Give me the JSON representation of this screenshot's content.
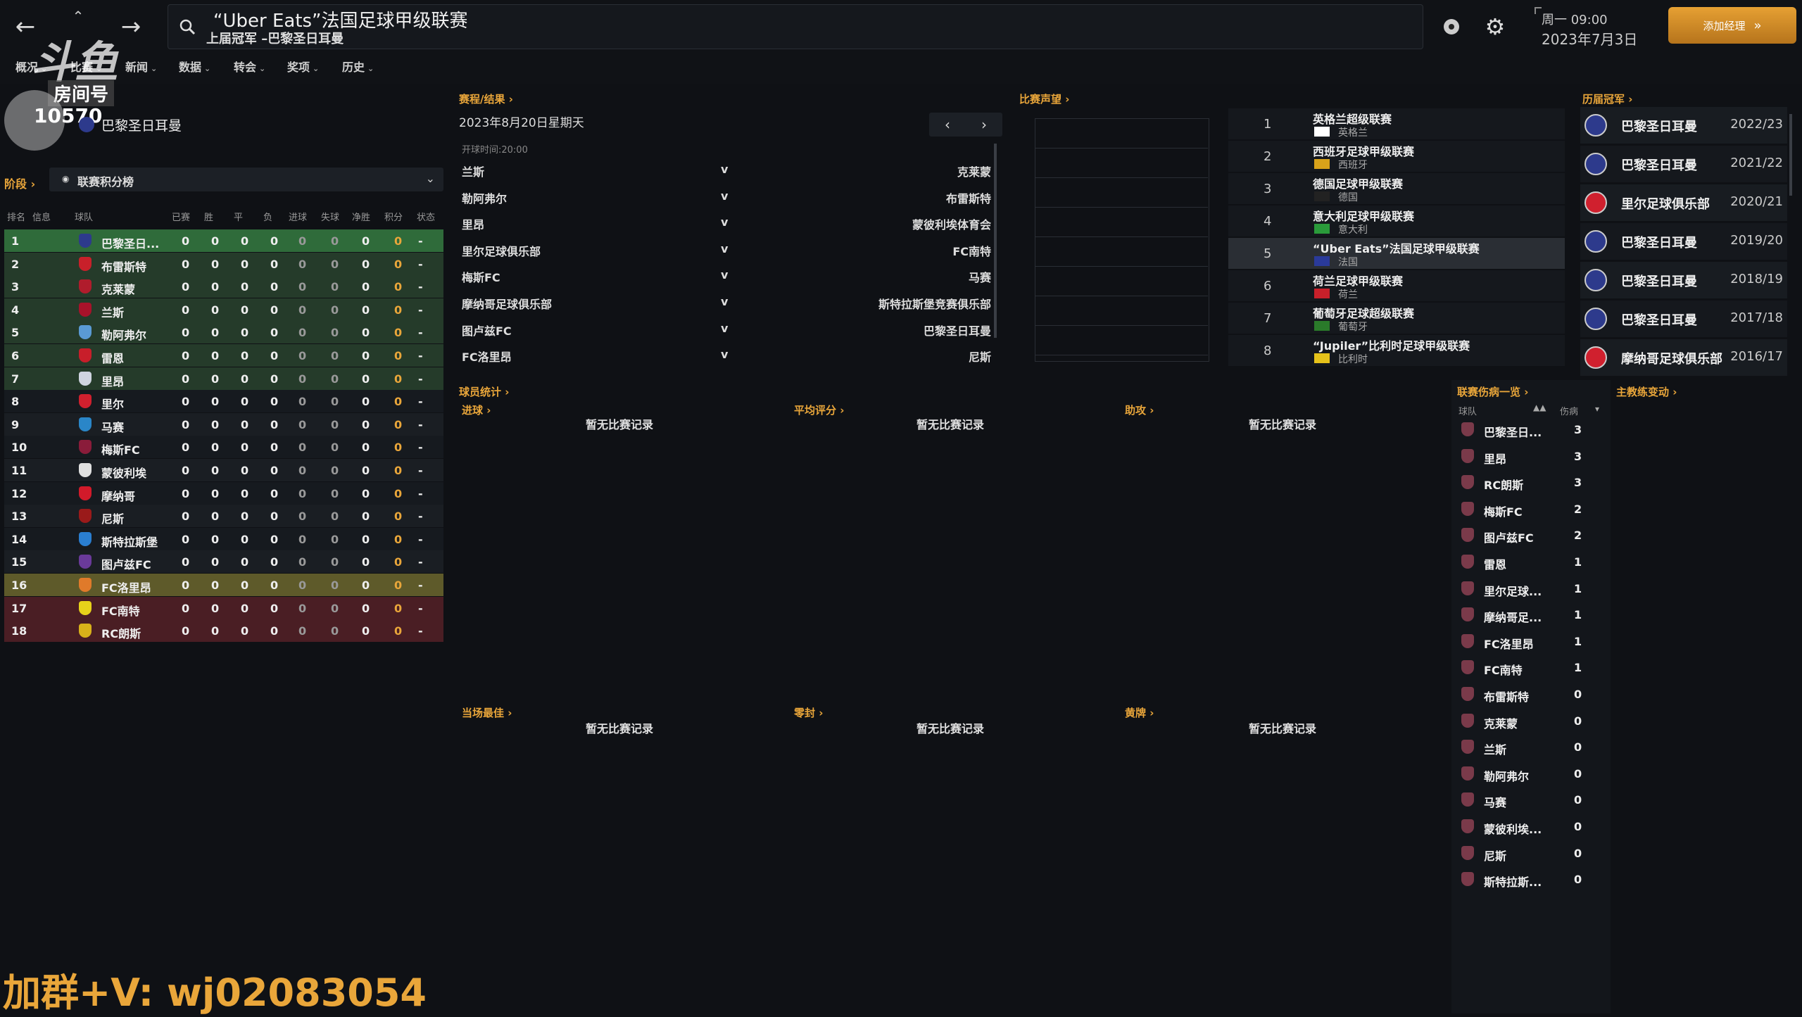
{
  "header": {
    "league_title": "“Uber Eats”法国足球甲级联赛",
    "last_champion": "上届冠军 –巴黎圣日耳曼",
    "weekday_time": "周一 09:00",
    "date": "2023年7月3日",
    "add_manager_label": "添加经理",
    "watermark_logo": "斗鱼",
    "room_label": "房间号",
    "room_number": "10570"
  },
  "menu": [
    {
      "label": "概况"
    },
    {
      "label": "比赛"
    },
    {
      "label": "新闻"
    },
    {
      "label": "数据"
    },
    {
      "label": "转会"
    },
    {
      "label": "奖项"
    },
    {
      "label": "历史"
    }
  ],
  "club_header": {
    "name": "巴黎圣日耳曼"
  },
  "stage": {
    "label": "阶段",
    "selector_label": "联赛积分榜"
  },
  "standings": {
    "columns": [
      "排名",
      "信息",
      "球队",
      "已赛",
      "胜",
      "平",
      "负",
      "进球",
      "失球",
      "净胜",
      "积分",
      "状态"
    ],
    "rows": [
      {
        "pos": "1",
        "team": "巴黎圣日...",
        "p": "0",
        "w": "0",
        "d": "0",
        "l": "0",
        "gf": "0",
        "ga": "0",
        "gd": "0",
        "pts": "0",
        "form": "-",
        "crest": "#2d3a8c"
      },
      {
        "pos": "2",
        "team": "布雷斯特",
        "p": "0",
        "w": "0",
        "d": "0",
        "l": "0",
        "gf": "0",
        "ga": "0",
        "gd": "0",
        "pts": "0",
        "form": "-",
        "crest": "#c8202a"
      },
      {
        "pos": "3",
        "team": "克莱蒙",
        "p": "0",
        "w": "0",
        "d": "0",
        "l": "0",
        "gf": "0",
        "ga": "0",
        "gd": "0",
        "pts": "0",
        "form": "-",
        "crest": "#b01c2c"
      },
      {
        "pos": "4",
        "team": "兰斯",
        "p": "0",
        "w": "0",
        "d": "0",
        "l": "0",
        "gf": "0",
        "ga": "0",
        "gd": "0",
        "pts": "0",
        "form": "-",
        "crest": "#a8122a"
      },
      {
        "pos": "5",
        "team": "勒阿弗尔",
        "p": "0",
        "w": "0",
        "d": "0",
        "l": "0",
        "gf": "0",
        "ga": "0",
        "gd": "0",
        "pts": "0",
        "form": "-",
        "crest": "#5a9ad4"
      },
      {
        "pos": "6",
        "team": "雷恩",
        "p": "0",
        "w": "0",
        "d": "0",
        "l": "0",
        "gf": "0",
        "ga": "0",
        "gd": "0",
        "pts": "0",
        "form": "-",
        "crest": "#c81e2a"
      },
      {
        "pos": "7",
        "team": "里昂",
        "p": "0",
        "w": "0",
        "d": "0",
        "l": "0",
        "gf": "0",
        "ga": "0",
        "gd": "0",
        "pts": "0",
        "form": "-",
        "crest": "#cfd4e0"
      },
      {
        "pos": "8",
        "team": "里尔",
        "p": "0",
        "w": "0",
        "d": "0",
        "l": "0",
        "gf": "0",
        "ga": "0",
        "gd": "0",
        "pts": "0",
        "form": "-",
        "crest": "#d0202e"
      },
      {
        "pos": "9",
        "team": "马赛",
        "p": "0",
        "w": "0",
        "d": "0",
        "l": "0",
        "gf": "0",
        "ga": "0",
        "gd": "0",
        "pts": "0",
        "form": "-",
        "crest": "#2a86c8"
      },
      {
        "pos": "10",
        "team": "梅斯FC",
        "p": "0",
        "w": "0",
        "d": "0",
        "l": "0",
        "gf": "0",
        "ga": "0",
        "gd": "0",
        "pts": "0",
        "form": "-",
        "crest": "#8a1c3a"
      },
      {
        "pos": "11",
        "team": "蒙彼利埃",
        "p": "0",
        "w": "0",
        "d": "0",
        "l": "0",
        "gf": "0",
        "ga": "0",
        "gd": "0",
        "pts": "0",
        "form": "-",
        "crest": "#e0e0e0"
      },
      {
        "pos": "12",
        "team": "摩纳哥",
        "p": "0",
        "w": "0",
        "d": "0",
        "l": "0",
        "gf": "0",
        "ga": "0",
        "gd": "0",
        "pts": "0",
        "form": "-",
        "crest": "#d21a2a"
      },
      {
        "pos": "13",
        "team": "尼斯",
        "p": "0",
        "w": "0",
        "d": "0",
        "l": "0",
        "gf": "0",
        "ga": "0",
        "gd": "0",
        "pts": "0",
        "form": "-",
        "crest": "#9a1a1a"
      },
      {
        "pos": "14",
        "team": "斯特拉斯堡",
        "p": "0",
        "w": "0",
        "d": "0",
        "l": "0",
        "gf": "0",
        "ga": "0",
        "gd": "0",
        "pts": "0",
        "form": "-",
        "crest": "#2a7ed0"
      },
      {
        "pos": "15",
        "team": "图卢兹FC",
        "p": "0",
        "w": "0",
        "d": "0",
        "l": "0",
        "gf": "0",
        "ga": "0",
        "gd": "0",
        "pts": "0",
        "form": "-",
        "crest": "#6a3a9a"
      },
      {
        "pos": "16",
        "team": "FC洛里昂",
        "p": "0",
        "w": "0",
        "d": "0",
        "l": "0",
        "gf": "0",
        "ga": "0",
        "gd": "0",
        "pts": "0",
        "form": "-",
        "crest": "#e07a2a"
      },
      {
        "pos": "17",
        "team": "FC南特",
        "p": "0",
        "w": "0",
        "d": "0",
        "l": "0",
        "gf": "0",
        "ga": "0",
        "gd": "0",
        "pts": "0",
        "form": "-",
        "crest": "#e6d21a"
      },
      {
        "pos": "18",
        "team": "RC朗斯",
        "p": "0",
        "w": "0",
        "d": "0",
        "l": "0",
        "gf": "0",
        "ga": "0",
        "gd": "0",
        "pts": "0",
        "form": "-",
        "crest": "#d8b21a"
      }
    ]
  },
  "fixtures": {
    "title": "赛程/结果",
    "date": "2023年8月20日星期天",
    "kickoff": "开球时间:20:00",
    "vs": "v",
    "matches": [
      {
        "home": "兰斯",
        "away": "克莱蒙"
      },
      {
        "home": "勒阿弗尔",
        "away": "布雷斯特"
      },
      {
        "home": "里昂",
        "away": "蒙彼利埃体育会"
      },
      {
        "home": "里尔足球俱乐部",
        "away": "FC南特"
      },
      {
        "home": "梅斯FC",
        "away": "马赛"
      },
      {
        "home": "摩纳哥足球俱乐部",
        "away": "斯特拉斯堡竞赛俱乐部"
      },
      {
        "home": "图卢兹FC",
        "away": "巴黎圣日耳曼"
      },
      {
        "home": "FC洛里昂",
        "away": "尼斯"
      }
    ]
  },
  "reputation": {
    "title": "比赛声望",
    "leagues": [
      {
        "rank": "1",
        "name": "英格兰超级联赛",
        "country": "英格兰"
      },
      {
        "rank": "2",
        "name": "西班牙足球甲级联赛",
        "country": "西班牙"
      },
      {
        "rank": "3",
        "name": "德国足球甲级联赛",
        "country": "德国"
      },
      {
        "rank": "4",
        "name": "意大利足球甲级联赛",
        "country": "意大利"
      },
      {
        "rank": "5",
        "name": "“Uber Eats”法国足球甲级联赛",
        "country": "法国"
      },
      {
        "rank": "6",
        "name": "荷兰足球甲级联赛",
        "country": "荷兰"
      },
      {
        "rank": "7",
        "name": "葡萄牙足球超级联赛",
        "country": "葡萄牙"
      },
      {
        "rank": "8",
        "name": "“Jupiler”比利时足球甲级联赛",
        "country": "比利时"
      }
    ]
  },
  "champions": {
    "title": "历届冠军",
    "list": [
      {
        "team": "巴黎圣日耳曼",
        "season": "2022/23"
      },
      {
        "team": "巴黎圣日耳曼",
        "season": "2021/22"
      },
      {
        "team": "里尔足球俱乐部",
        "season": "2020/21"
      },
      {
        "team": "巴黎圣日耳曼",
        "season": "2019/20"
      },
      {
        "team": "巴黎圣日耳曼",
        "season": "2018/19"
      },
      {
        "team": "巴黎圣日耳曼",
        "season": "2017/18"
      },
      {
        "team": "摩纳哥足球俱乐部",
        "season": "2016/17"
      }
    ]
  },
  "player_stats": {
    "title": "球员统计",
    "no_record": "暂无比赛记录",
    "goals": "进球",
    "avg_rating": "平均评分",
    "assists": "助攻",
    "man_of_match": "当场最佳",
    "clean_sheets": "零封",
    "yellow_cards": "黄牌"
  },
  "injuries": {
    "title": "联赛伤病一览",
    "col_team": "球队",
    "col_injuries": "伤病",
    "rows": [
      {
        "team": "巴黎圣日...",
        "count": "3"
      },
      {
        "team": "里昂",
        "count": "3"
      },
      {
        "team": "RC朗斯",
        "count": "3"
      },
      {
        "team": "梅斯FC",
        "count": "2"
      },
      {
        "team": "图卢兹FC",
        "count": "2"
      },
      {
        "team": "雷恩",
        "count": "1"
      },
      {
        "team": "里尔足球...",
        "count": "1"
      },
      {
        "team": "摩纳哥足...",
        "count": "1"
      },
      {
        "team": "FC洛里昂",
        "count": "1"
      },
      {
        "team": "FC南特",
        "count": "1"
      },
      {
        "team": "布雷斯特",
        "count": "0"
      },
      {
        "team": "克莱蒙",
        "count": "0"
      },
      {
        "team": "兰斯",
        "count": "0"
      },
      {
        "team": "勒阿弗尔",
        "count": "0"
      },
      {
        "team": "马赛",
        "count": "0"
      },
      {
        "team": "蒙彼利埃...",
        "count": "0"
      },
      {
        "team": "尼斯",
        "count": "0"
      },
      {
        "team": "斯特拉斯...",
        "count": "0"
      }
    ]
  },
  "manager_changes": {
    "title": "主教练变动"
  },
  "overlay_text": "加群+V: wj02083054",
  "colors": {
    "accent": "#e9a63a",
    "green": "#2f6b3a",
    "yellow": "#6b6a2e",
    "red": "#5a1e24"
  }
}
